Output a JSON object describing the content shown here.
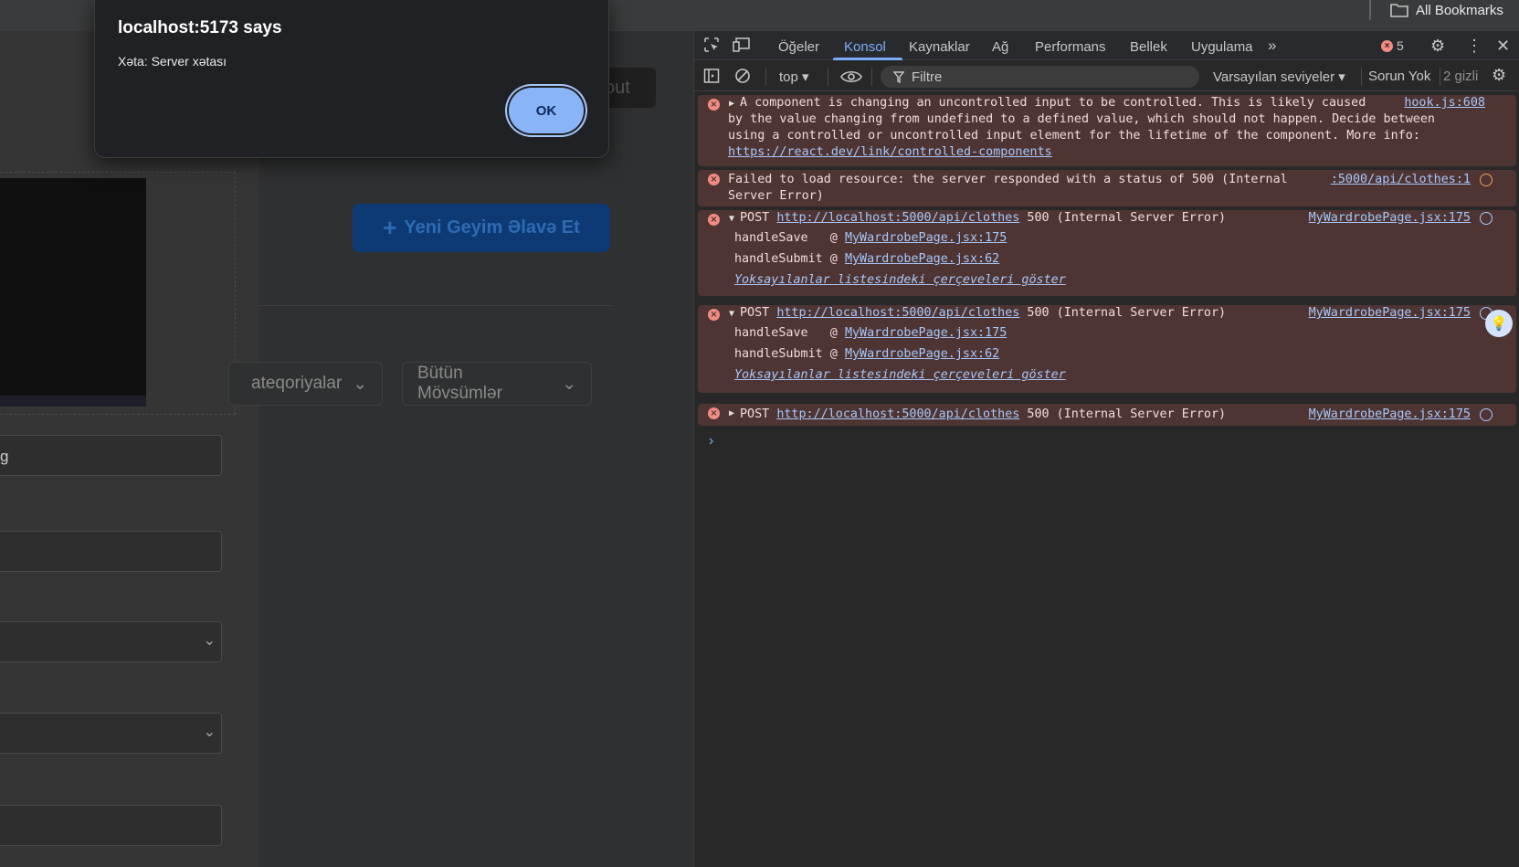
{
  "browser": {
    "bookmarks_label": "All Bookmarks"
  },
  "page": {
    "logout_text": "out",
    "add_button_label": "Yeni Geyim Əlavə Et",
    "filter_category": "ateqoriyalar",
    "filter_season": "Bütün Mövsümlər",
    "fields": [
      {
        "value": "g"
      },
      {
        "value": ""
      },
      {
        "value": ""
      },
      {
        "value": ""
      },
      {
        "value": ""
      }
    ]
  },
  "alert": {
    "title": "localhost:5173 says",
    "message": "Xəta: Server xətası",
    "ok_label": "OK"
  },
  "devtools": {
    "tabs": [
      "Öğeler",
      "Konsol",
      "Kaynaklar",
      "Ağ",
      "Performans",
      "Bellek",
      "Uygulama"
    ],
    "error_count": "5",
    "context": "top",
    "filter_placeholder": "Filtre",
    "levels": "Varsayılan seviyeler",
    "issues": "Sorun Yok",
    "hidden": "2 gizli",
    "messages": [
      {
        "lines": [
          "A component is changing an uncontrolled input to be controlled. This is likely caused",
          "by the value changing from undefined to a defined value, which should not happen. Decide between",
          "using a controlled or uncontrolled input element for the lifetime of the component. More info:"
        ],
        "link": "https://react.dev/link/controlled-components",
        "source": "hook.js:608"
      },
      {
        "lines": [
          "Failed to load resource: the server responded with a status of 500 (Internal",
          "Server Error)"
        ],
        "source": ":5000/api/clothes:1"
      },
      {
        "method": "POST",
        "url": "http://localhost:5000/api/clothes",
        "status": "500 (Internal Server Error)",
        "source": "MyWardrobePage.jsx:175",
        "stack": [
          {
            "fn": "handleSave  ",
            "at": "MyWardrobePage.jsx:175"
          },
          {
            "fn": "handleSubmit",
            "at": "MyWardrobePage.jsx:62"
          }
        ],
        "ignored_link": "Yoksayılanlar listesindeki çerçeveleri göster"
      },
      {
        "method": "POST",
        "url": "http://localhost:5000/api/clothes",
        "status": "500 (Internal Server Error)",
        "source": "MyWardrobePage.jsx:175",
        "stack": [
          {
            "fn": "handleSave  ",
            "at": "MyWardrobePage.jsx:175"
          },
          {
            "fn": "handleSubmit",
            "at": "MyWardrobePage.jsx:62"
          }
        ],
        "ignored_link": "Yoksayılanlar listesindeki çerçeveleri göster"
      },
      {
        "method": "POST",
        "url": "http://localhost:5000/api/clothes",
        "status": "500 (Internal Server Error)",
        "source": "MyWardrobePage.jsx:175"
      }
    ]
  }
}
